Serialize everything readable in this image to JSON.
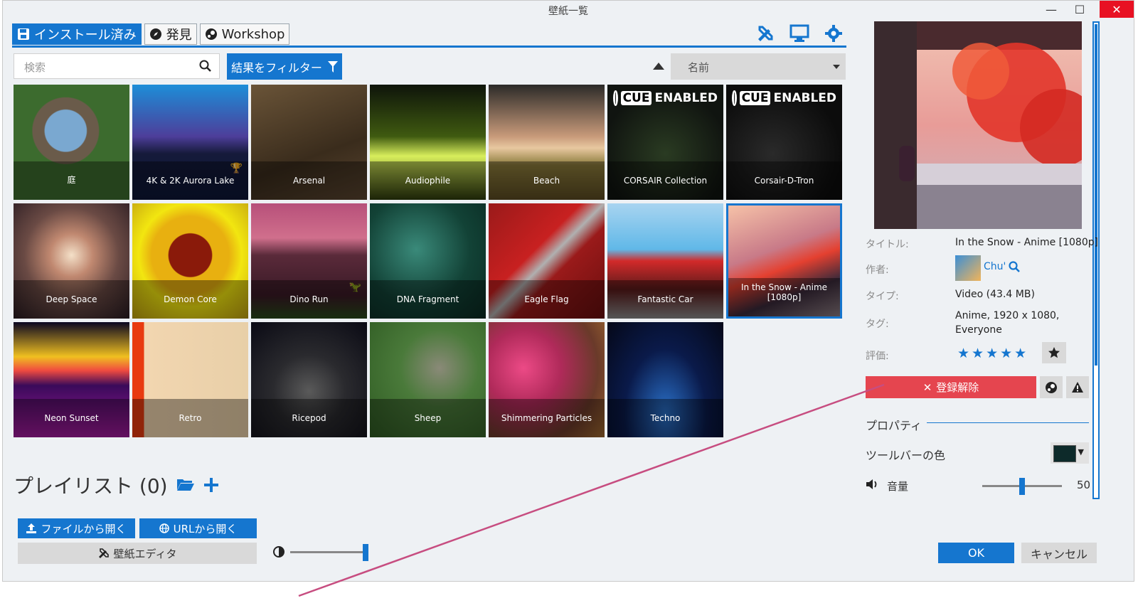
{
  "window": {
    "title": "壁紙一覧",
    "min": "—",
    "max": "☐",
    "close": "✕"
  },
  "tabs": [
    {
      "label": "インストール済み",
      "icon": "save-icon"
    },
    {
      "label": "発見",
      "icon": "compass-icon"
    },
    {
      "label": "Workshop",
      "icon": "steam-icon"
    }
  ],
  "toolbar_icons": [
    "editor-tools-icon",
    "monitor-icon",
    "gear-icon"
  ],
  "search": {
    "placeholder": "検索"
  },
  "filter": {
    "label": "結果をフィルター"
  },
  "sort": {
    "value": "名前"
  },
  "wallpapers": [
    {
      "label": "庭",
      "bg": "radial-gradient(circle at 45% 40%, #7aa8d0 0 22%, #6a5b4a 23% 35%, #3c6b2e 36%)"
    },
    {
      "label": "4K & 2K Aurora Lake",
      "bg": "linear-gradient(180deg,#1d8ed8 0%,#4d3e9a 45%,#151a3a 60%,#0d1636 100%)",
      "trophy": "🏆"
    },
    {
      "label": "Arsenal",
      "bg": "linear-gradient(160deg,#6a5438 0%,#3a2c1c 60%,#5a4530 100%)"
    },
    {
      "label": "Audiophile",
      "bg": "linear-gradient(180deg,#0e140a 0%,#3f5a10 45%,#d8ee5c 62%,#2d3a0c 100%)"
    },
    {
      "label": "Beach",
      "bg": "linear-gradient(180deg,#2b2a28 0%,#c89a7a 45%,#e8c8a0 55%,#8a7a3a 70%,#5a4a22 100%)"
    },
    {
      "label": "CORSAIR Collection",
      "bg": "radial-gradient(circle at 50% 60%, #2a3b22 0%, #101410 70%)",
      "cue_a": "CUE",
      "cue_b": "ENABLED"
    },
    {
      "label": "Corsair-D-Tron",
      "bg": "radial-gradient(circle at 40% 60%, #2a2a2a 0%, #0c0c0c 70%)",
      "cue_a": "CUE",
      "cue_b": "ENABLED"
    },
    {
      "label": "Deep Space",
      "bg": "radial-gradient(circle at 50% 45%, #f4e0c8 0%, #c08870 25%, #6a4a44 55%, #2a1c22 100%)"
    },
    {
      "label": "Demon Core",
      "bg": "radial-gradient(circle at 50% 45%, #8a1a0a 0 25%, #e8b010 26% 45%, #f2e610 60%, #c0a010 100%)"
    },
    {
      "label": "Dino Run",
      "bg": "linear-gradient(180deg,#b7507a 0%,#d06f8c 30%,#5a2a3a 45%,#3a1a26 80%,#2a4a1a 100%)",
      "trophy": "🦖"
    },
    {
      "label": "DNA Fragment",
      "bg": "radial-gradient(circle at 40% 40%, #3a8a7a 0%, #124236 55%, #0a2a22 100%)"
    },
    {
      "label": "Eagle Flag",
      "bg": "linear-gradient(135deg,#9a1a1a 0%,#c82020 40%,#b0b0b0 50%,#9a1a1a 60%,#6a0e0e 100%)"
    },
    {
      "label": "Fantastic Car",
      "bg": "linear-gradient(180deg,#a8d4f0 0%,#60b8e8 40%,#d22a2a 50%,#5a1a1a 75%,#8a8a8a 100%)"
    },
    {
      "label": "In the Snow - Anime [1080p]",
      "bg": "linear-gradient(160deg,#f6c2a8 0%,#c87a88 40%,#e44030 55%,#3a2a3a 75%,#8a7a80 100%)",
      "selected": true
    },
    {
      "label": "Neon Sunset",
      "bg": "linear-gradient(180deg,#0a0620 0%,#f0c020 30%,#f04a40 42%,#3a0a5a 55%,#a01a9a 100%)"
    },
    {
      "label": "Retro",
      "bg": "linear-gradient(90deg,#e83a10 0%,#e83a10 10%,#f2d6b0 10%,#e8cfa8 100%)"
    },
    {
      "label": "Ricepod",
      "bg": "radial-gradient(circle at 50% 60%, #5a5a5a 0%, #2a2a2e 40%, #0a0a14 100%)"
    },
    {
      "label": "Sheep",
      "bg": "radial-gradient(circle at 60% 40%, #8a8a78 0%, #4a7a3a 40%, #2e5a22 100%)"
    },
    {
      "label": "Shimmering Particles",
      "bg": "radial-gradient(circle at 30% 40%, #ec4a86 0%, #b02a5a 35%, #6a3a2a 70%, #a06a30 100%)"
    },
    {
      "label": "Techno",
      "bg": "radial-gradient(ellipse at 50% 80%, #2a70c8 0%, #0a1a4a 50%, #050818 100%)"
    }
  ],
  "playlist": {
    "title": "プレイリスト (0)"
  },
  "buttons": {
    "open_file": "ファイルから開く",
    "open_url": "URLから開く",
    "editor": "壁紙エディタ",
    "ok": "OK",
    "cancel": "キャンセル"
  },
  "details": {
    "title_label": "タイトル:",
    "title_value": "In the Snow - Anime [1080p]",
    "author_label": "作者:",
    "author_value": "Chu'",
    "type_label": "タイプ:",
    "type_value": "Video (43.4 MB)",
    "tags_label": "タグ:",
    "tags_line1": "Anime, 1920 x 1080,",
    "tags_line2": "Everyone",
    "rating_label": "評価:",
    "rating_stars": "★★★★★",
    "unsubscribe": "登録解除"
  },
  "properties": {
    "section_title": "プロパティ",
    "toolbar_color_label": "ツールバーの色",
    "toolbar_color": "#0d2a2a",
    "volume_label": "音量",
    "volume_value": "50"
  },
  "colors": {
    "accent": "#1576cf",
    "danger": "#e5454f"
  }
}
